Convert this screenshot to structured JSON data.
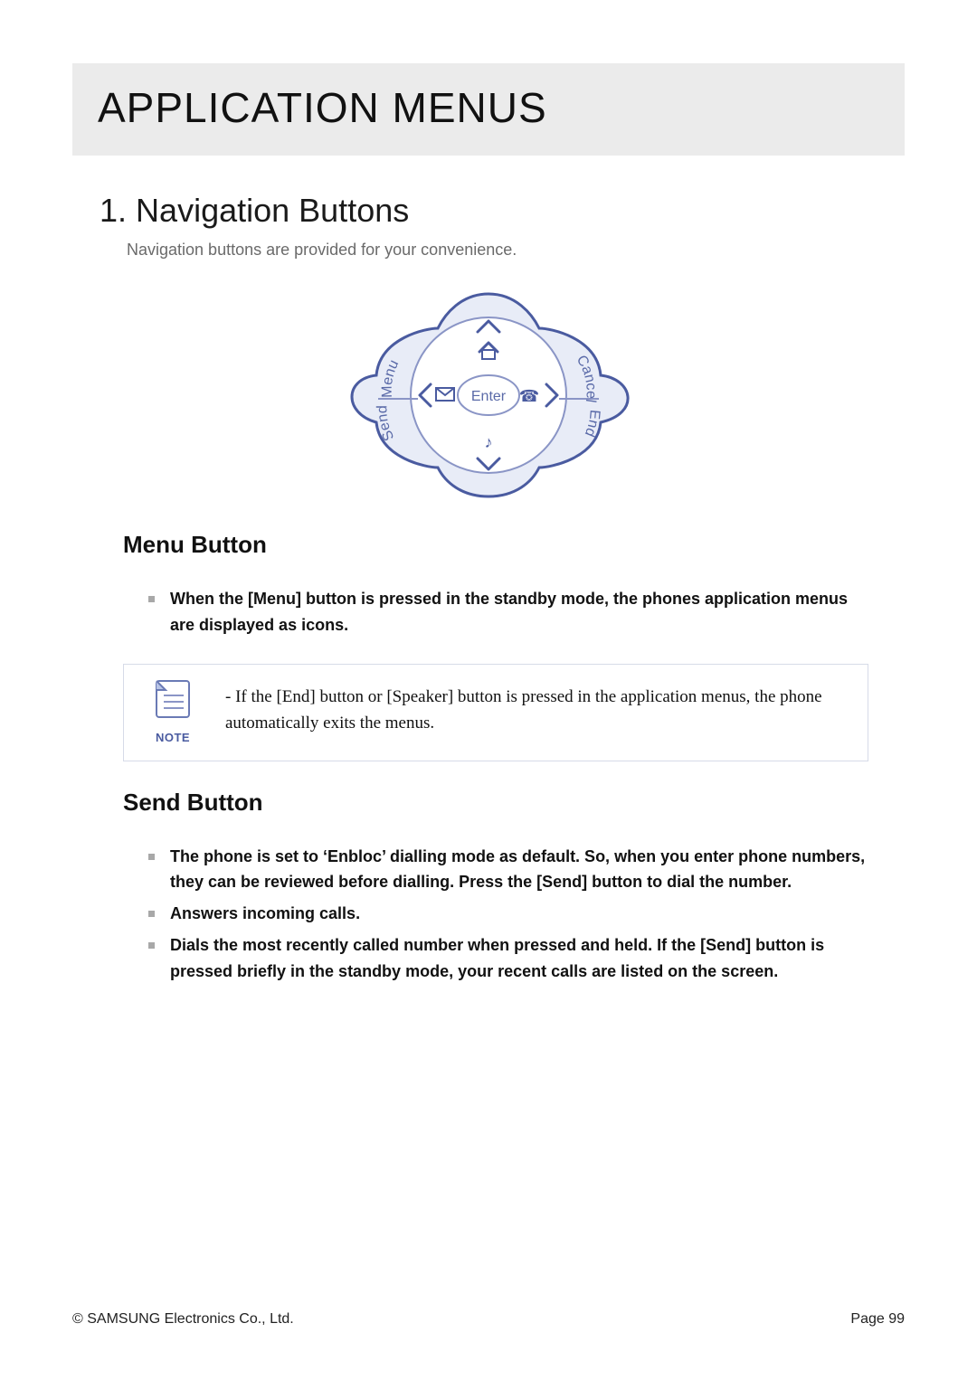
{
  "title": "APPLICATION MENUS",
  "section": {
    "number": "1.",
    "title": "Navigation Buttons",
    "intro": "Navigation buttons are provided for your convenience."
  },
  "navpad": {
    "left_upper_label": "Menu",
    "left_lower_label": "Send",
    "right_upper_label": "Cancel",
    "right_lower_label": "End",
    "center_label": "Enter"
  },
  "menu_button": {
    "heading": "Menu Button",
    "bullets": [
      "When the [Menu] button is pressed in the standby mode, the phones application menus are displayed as icons."
    ]
  },
  "note": {
    "label": "NOTE",
    "text": "- If the [End] button or [Speaker] button is pressed in the application menus, the phone automatically exits the menus."
  },
  "send_button": {
    "heading": "Send Button",
    "bullets": [
      "The phone is set to ‘Enbloc’ dialling mode as default. So, when you enter phone numbers, they can be reviewed before dialling. Press the [Send] button to dial the number.",
      "Answers incoming calls.",
      "Dials the most recently called number when pressed and held. If the [Send] button is pressed briefly in the standby mode, your recent calls are listed on the screen."
    ]
  },
  "footer": {
    "copyright": "© SAMSUNG Electronics Co., Ltd.",
    "page": "Page 99"
  }
}
